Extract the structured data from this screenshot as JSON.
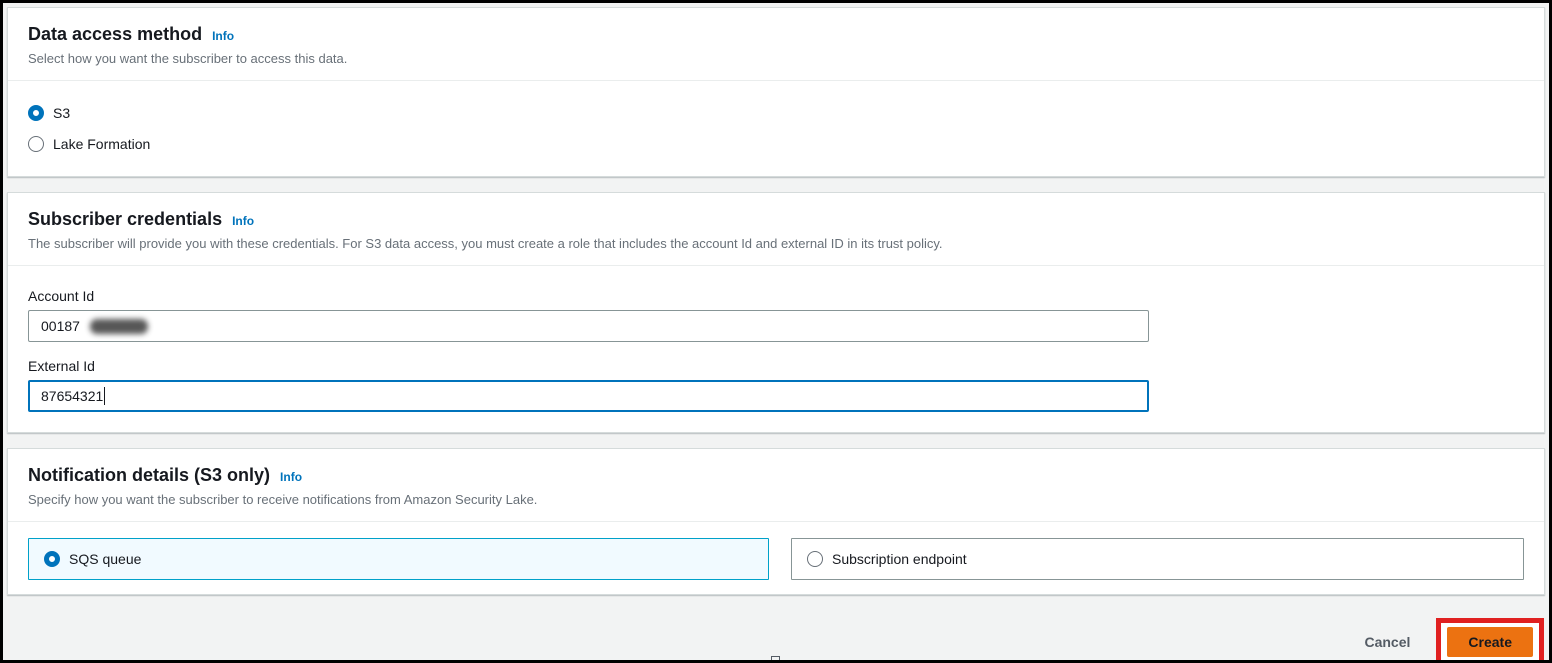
{
  "colors": {
    "accent_blue": "#0073bb",
    "selected_tile_border": "#00a1c9",
    "selected_tile_bg": "#f1faff",
    "primary_button_orange": "#ec7211",
    "annotation_red": "#e02020",
    "page_bg": "#f2f3f3"
  },
  "sections": {
    "data_access": {
      "title": "Data access method",
      "info": "Info",
      "description": "Select how you want the subscriber to access this data.",
      "options": {
        "s3": {
          "label": "S3",
          "selected": true
        },
        "lake_formation": {
          "label": "Lake Formation",
          "selected": false
        }
      }
    },
    "credentials": {
      "title": "Subscriber credentials",
      "info": "Info",
      "description": "The subscriber will provide you with these credentials. For S3 data access, you must create a role that includes the account Id and external ID in its trust policy.",
      "fields": {
        "account_id": {
          "label": "Account Id",
          "value": "00187",
          "redacted": true,
          "focused": false
        },
        "external_id": {
          "label": "External Id",
          "value": "87654321",
          "focused": true
        }
      }
    },
    "notification": {
      "title": "Notification details (S3 only)",
      "info": "Info",
      "description": "Specify how you want the subscriber to receive notifications from Amazon Security Lake.",
      "tiles": {
        "sqs": {
          "label": "SQS queue",
          "selected": true
        },
        "endpoint": {
          "label": "Subscription endpoint",
          "selected": false
        }
      }
    }
  },
  "footer": {
    "cancel_label": "Cancel",
    "create_label": "Create"
  }
}
